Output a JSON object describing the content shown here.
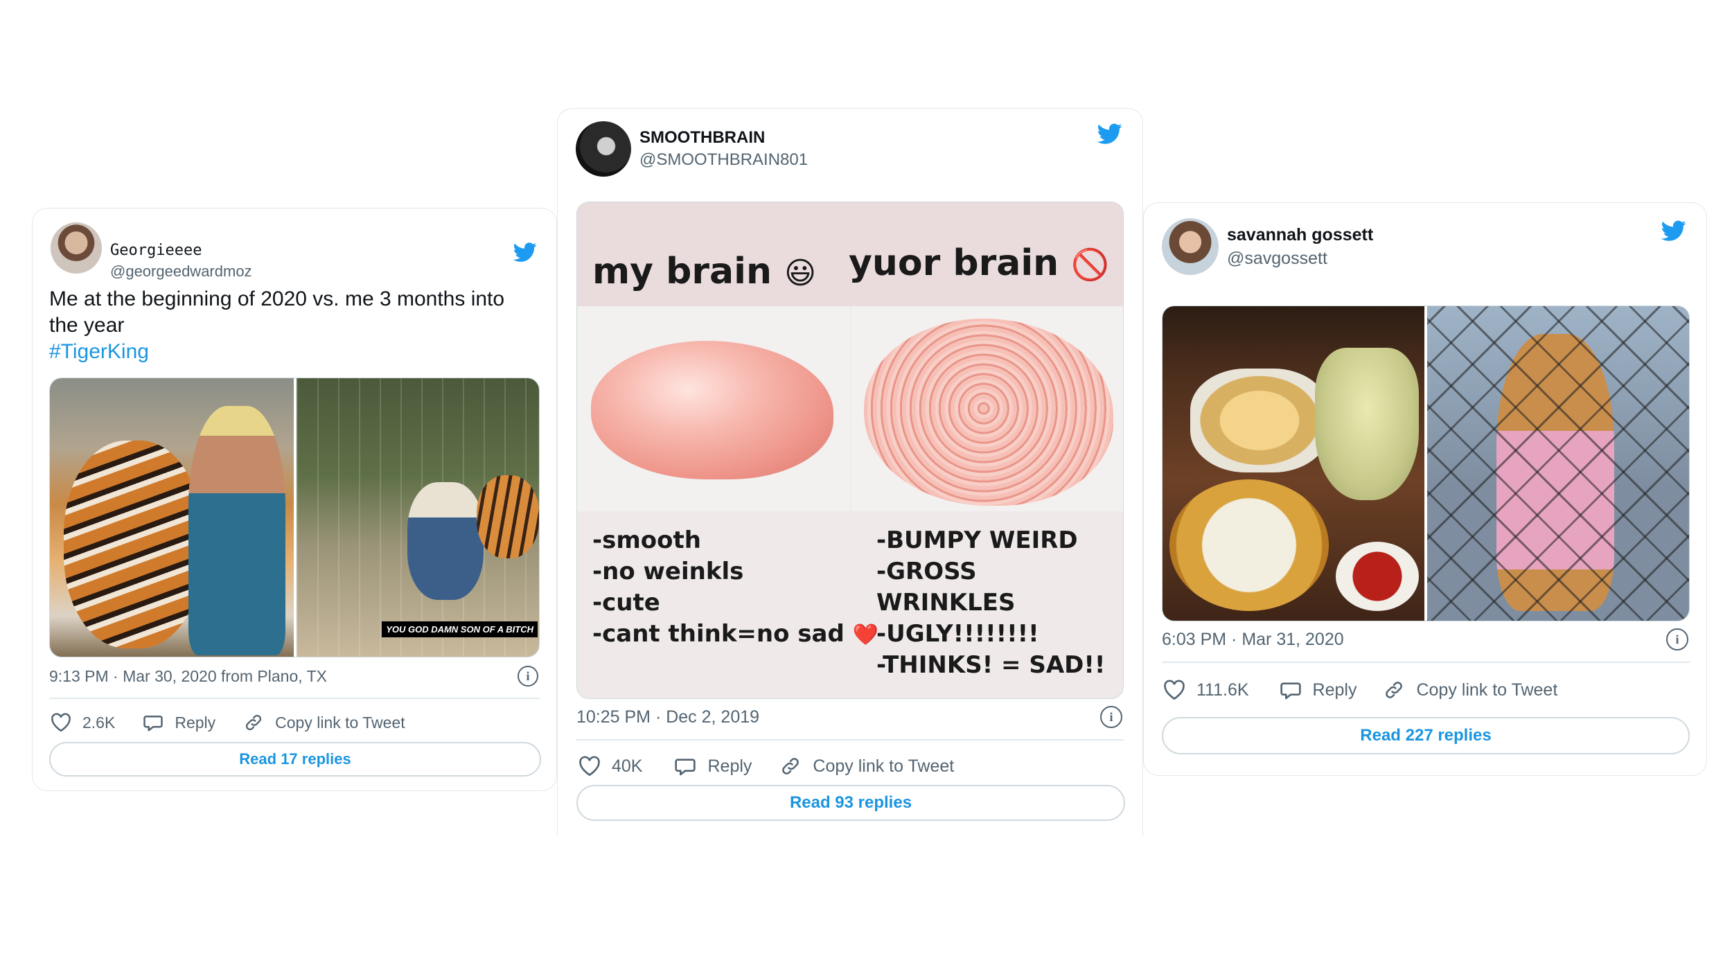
{
  "colors": {
    "link": "#1b95e0",
    "border": "#e1e8ed",
    "muted": "#536471",
    "twitter_blue": "#1d9bf0"
  },
  "tweets": [
    {
      "name": "Georgieeee",
      "handle": "@georgeedwardmoz",
      "text": "Me at the beginning of 2020 vs. me 3 months into the year",
      "hashtag": "#TigerKing",
      "caption": "YOU GOD DAMN SON OF A BITCH",
      "timestamp": "9:13 PM · Mar 30, 2020 from Plano, TX",
      "likes": "2.6K",
      "reply_label": "Reply",
      "copy_label": "Copy link to Tweet",
      "read_label": "Read 17 replies"
    },
    {
      "name": "SMOOTHBRAIN",
      "handle": "@SMOOTHBRAIN801",
      "meme": {
        "left_title": "my brain",
        "right_title": "yuor brain",
        "left_emoji": "😃",
        "right_emoji": "🚫",
        "left_list": [
          "-smooth",
          "-no weinkls",
          "-cute",
          "-cant think=no sad"
        ],
        "heart": "❤️",
        "right_list": [
          "-BUMPY WEIRD",
          "-GROSS WRINKLES",
          "-UGLY!!!!!!!!",
          "-THINKS! = SAD!!"
        ]
      },
      "timestamp": "10:25 PM · Dec 2, 2019",
      "likes": "40K",
      "reply_label": "Reply",
      "copy_label": "Copy link to Tweet",
      "read_label": "Read 93 replies"
    },
    {
      "name": "savannah gossett",
      "handle": "@savgossett",
      "timestamp": "6:03 PM · Mar 31, 2020",
      "likes": "111.6K",
      "reply_label": "Reply",
      "copy_label": "Copy link to Tweet",
      "read_label": "Read 227 replies"
    }
  ]
}
